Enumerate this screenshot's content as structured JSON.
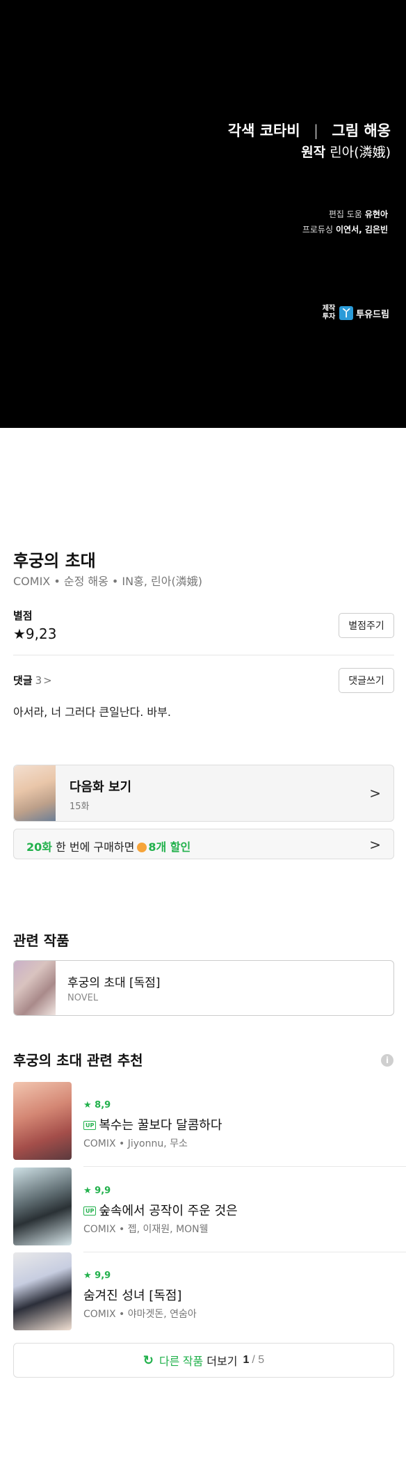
{
  "credits": {
    "adaptation_label": "각색",
    "adaptation_name": "코타비",
    "separator": "|",
    "art_label": "그림",
    "art_name": "해옹",
    "original_label": "원작",
    "original_name": "린아(潾娥)",
    "edit_label": "편집 도움",
    "edit_name": "유현아",
    "producing_label": "프로듀싱",
    "producing_names": "이연서, 김은빈",
    "producer_label_1": "제작",
    "producer_label_2": "투자",
    "producer_logo_glyph": "丫",
    "producer_name": "투유드림"
  },
  "work": {
    "title": "후궁의 초대",
    "meta": "COMIX • 순정   해옹 • IN홍, 린아(潾娥)"
  },
  "rating": {
    "label": "별점",
    "value": "★9,23",
    "button": "별점주기"
  },
  "comments": {
    "label": "댓글",
    "count": "3",
    "chevron": ">",
    "button": "댓글쓰기",
    "top_comment": "아서라, 너 그러다 큰일난다. 바부."
  },
  "next_episode": {
    "title": "다음화 보기",
    "episode": "15화",
    "arrow": ">"
  },
  "discount": {
    "count": "20화",
    "text": " 한 번에 구매하면",
    "discount": "8개 할인",
    "arrow": ">"
  },
  "related": {
    "section_title": "관련 작품",
    "items": [
      {
        "title": "후궁의 초대 [독점]",
        "type": "NOVEL"
      }
    ]
  },
  "recommend": {
    "title_bold": "후궁의 초대",
    "title_rest": " 관련 추천",
    "info_icon": "i",
    "items": [
      {
        "rating": "★ 8,9",
        "badge": "UP",
        "title": "복수는 꿀보다 달콤하다",
        "sub": "COMIX • Jiyonnu, 무소"
      },
      {
        "rating": "★ 9,9",
        "badge": "UP",
        "title": "숲속에서 공작이 주운 것은",
        "sub": "COMIX • 젭, 이재원, MON웰"
      },
      {
        "rating": "★ 9,9",
        "badge": "",
        "title": "숨겨진 성녀 [독점]",
        "sub": "COMIX • 야마겟돈, 연숨아"
      }
    ],
    "more": {
      "refresh_icon": "↻",
      "label_green": "다른 작품",
      "label": "더보기",
      "page": "1",
      "total": "/ 5"
    }
  },
  "colors": {
    "accent_green": "#22b14c",
    "credits_bg": "#000000"
  }
}
